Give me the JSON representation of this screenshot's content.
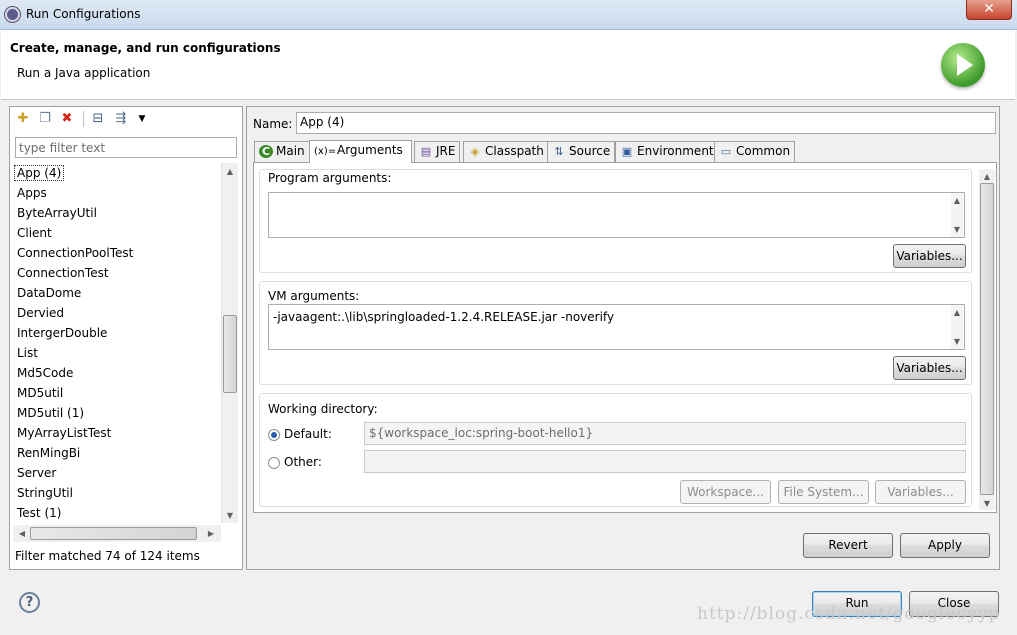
{
  "window": {
    "title": "Run Configurations",
    "close_symbol": "✕"
  },
  "header": {
    "title": "Create, manage, and run configurations",
    "subtitle": "Run a Java application"
  },
  "toolbar": {
    "icons": [
      "new-config-icon",
      "duplicate-icon",
      "delete-icon",
      "collapse-all-icon",
      "filter-icon",
      "dropdown-arrow-icon"
    ]
  },
  "filter": {
    "placeholder": "type filter text"
  },
  "configs": [
    {
      "label": "App (4)",
      "selected": true
    },
    {
      "label": "Apps"
    },
    {
      "label": "ByteArrayUtil"
    },
    {
      "label": "Client"
    },
    {
      "label": "ConnectionPoolTest"
    },
    {
      "label": "ConnectionTest"
    },
    {
      "label": "DataDome"
    },
    {
      "label": "Dervied"
    },
    {
      "label": "IntergerDouble"
    },
    {
      "label": "List"
    },
    {
      "label": "Md5Code"
    },
    {
      "label": "MD5util"
    },
    {
      "label": "MD5util (1)"
    },
    {
      "label": "MyArrayListTest"
    },
    {
      "label": "RenMingBi"
    },
    {
      "label": "Server"
    },
    {
      "label": "StringUtil"
    },
    {
      "label": "Test (1)"
    }
  ],
  "filter_status": "Filter matched 74 of 124 items",
  "name": {
    "label": "Name:",
    "value": "App (4)"
  },
  "tabs": [
    {
      "label": "Main",
      "icon": "C"
    },
    {
      "label": "Arguments",
      "icon": "(x)="
    },
    {
      "label": "JRE",
      "icon": "▤"
    },
    {
      "label": "Classpath",
      "icon": "◈"
    },
    {
      "label": "Source",
      "icon": "⇅"
    },
    {
      "label": "Environment",
      "icon": "▣"
    },
    {
      "label": "Common",
      "icon": "▭"
    }
  ],
  "arguments": {
    "program_label": "Program arguments:",
    "program_value": "",
    "vm_label": "VM arguments:",
    "vm_value": "-javaagent:.\\lib\\springloaded-1.2.4.RELEASE.jar -noverify",
    "variables_label": "Variables...",
    "workdir_label": "Working directory:",
    "default_label": "Default:",
    "default_value": "${workspace_loc:spring-boot-hello1}",
    "other_label": "Other:",
    "other_value": "",
    "workspace_btn": "Workspace...",
    "filesystem_btn": "File System...",
    "variables_btn": "Variables..."
  },
  "actions": {
    "revert": "Revert",
    "apply": "Apply",
    "run": "Run",
    "close": "Close"
  },
  "help_symbol": "?",
  "watermark": "http://blog.csdn.net/googleoyyp"
}
